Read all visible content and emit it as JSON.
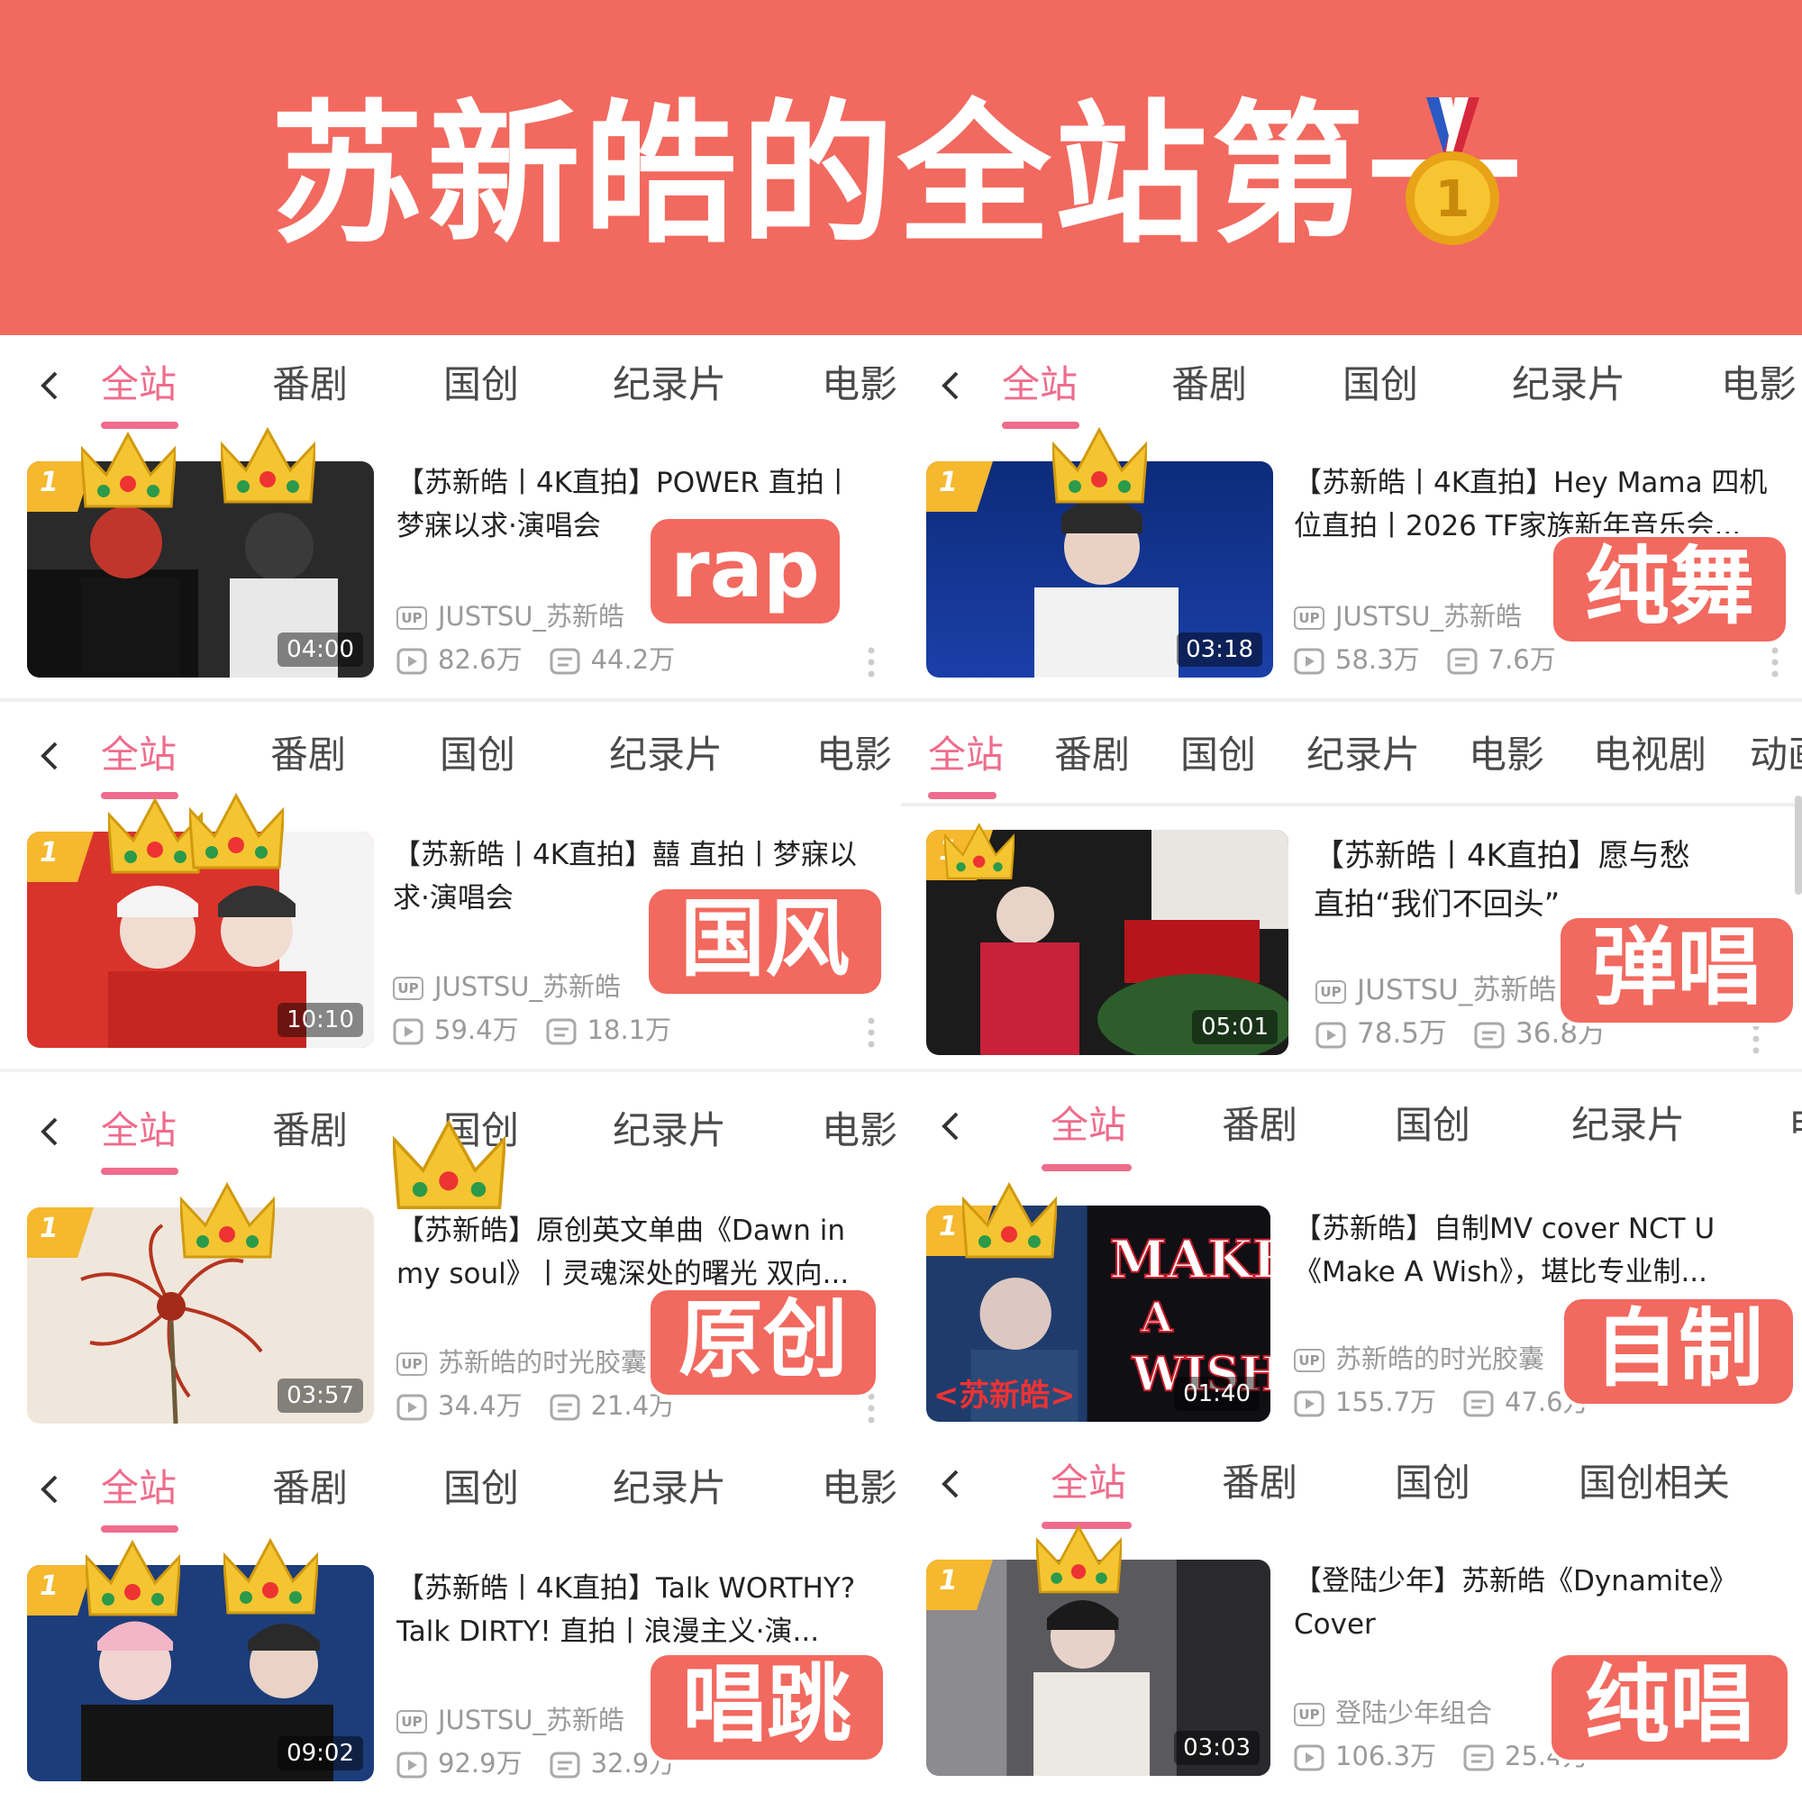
{
  "banner": {
    "title": "苏新皓的全站第一"
  },
  "colors": {
    "accent": "#EE6C8C",
    "banner": "#F2695F",
    "tag": "#F2695F"
  },
  "panels": [
    {
      "tabs": [
        "全站",
        "番剧",
        "国创",
        "纪录片",
        "电影"
      ],
      "rank": "1",
      "duration": "04:00",
      "title_lines": [
        "【苏新皓丨4K直拍】POWER 直拍丨",
        "梦寐以求·演唱会"
      ],
      "author": "JUSTSU_苏新皓",
      "views": "82.6万",
      "danmaku": "44.2万",
      "label": "rap"
    },
    {
      "tabs": [
        "全站",
        "番剧",
        "国创",
        "纪录片",
        "电影"
      ],
      "rank": "1",
      "duration": "03:18",
      "title_lines": [
        "【苏新皓丨4K直拍】Hey Mama 四机",
        "位直拍丨2026 TF家族新年音乐会..."
      ],
      "author": "JUSTSU_苏新皓",
      "views": "58.3万",
      "danmaku": "7.6万",
      "label": "纯舞"
    },
    {
      "tabs": [
        "全站",
        "番剧",
        "国创",
        "纪录片",
        "电影"
      ],
      "rank": "1",
      "duration": "10:10",
      "title_lines": [
        "【苏新皓丨4K直拍】囍 直拍丨梦寐以",
        "求·演唱会"
      ],
      "author": "JUSTSU_苏新皓",
      "views": "59.4万",
      "danmaku": "18.1万",
      "label": "国风"
    },
    {
      "tabs": [
        "全站",
        "番剧",
        "国创",
        "纪录片",
        "电影",
        "电视剧",
        "动画"
      ],
      "rank": "1",
      "duration": "05:01",
      "title_lines": [
        "【苏新皓丨4K直拍】愿与愁",
        "直拍“我们不回头”"
      ],
      "author": "JUSTSU_苏新皓",
      "views": "78.5万",
      "danmaku": "36.8万",
      "label": "弹唱"
    },
    {
      "tabs": [
        "全站",
        "番剧",
        "国创",
        "纪录片",
        "电影"
      ],
      "rank": "1",
      "duration": "03:57",
      "title_lines": [
        "【苏新皓】原创英文单曲《Dawn in",
        "my soul》丨灵魂深处的曙光 双向..."
      ],
      "author": "苏新皓的时光胶囊",
      "views": "34.4万",
      "danmaku": "21.4万",
      "label": "原创"
    },
    {
      "tabs": [
        "全站",
        "番剧",
        "国创",
        "纪录片",
        "电影"
      ],
      "rank": "1",
      "duration": "01:40",
      "title_lines": [
        "【苏新皓】自制MV cover NCT U",
        "《Make A Wish》，堪比专业制..."
      ],
      "author": "苏新皓的时光胶囊",
      "views": "155.7万",
      "danmaku": "47.6万",
      "label": "自制"
    },
    {
      "tabs": [
        "全站",
        "番剧",
        "国创",
        "纪录片",
        "电影"
      ],
      "rank": "1",
      "duration": "09:02",
      "title_lines": [
        "【苏新皓丨4K直拍】Talk WORTHY?",
        "Talk DIRTY! 直拍丨浪漫主义·演..."
      ],
      "author": "JUSTSU_苏新皓",
      "views": "92.9万",
      "danmaku": "32.9万",
      "label": "唱跳"
    },
    {
      "tabs": [
        "全站",
        "番剧",
        "国创",
        "国创相关"
      ],
      "rank": "1",
      "duration": "03:03",
      "title_lines": [
        "【登陆少年】苏新皓《Dynamite》",
        "Cover"
      ],
      "author": "登陆少年组合",
      "views": "106.3万",
      "danmaku": "25.4万",
      "label": "纯唱"
    }
  ]
}
